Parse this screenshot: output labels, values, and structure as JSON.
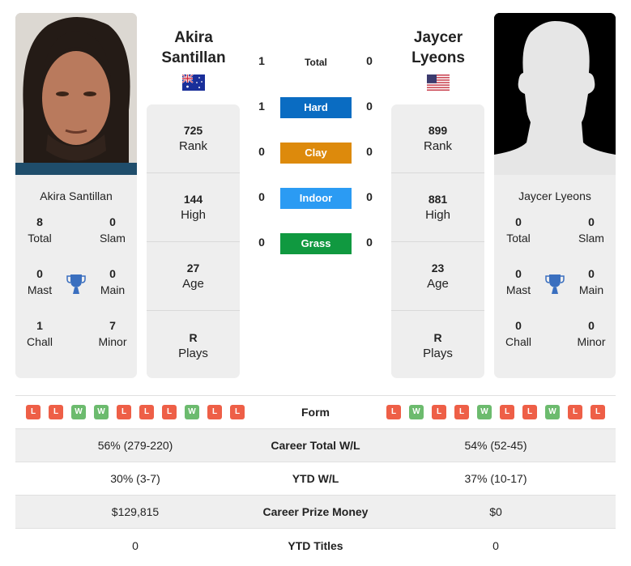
{
  "player1": {
    "name_line1": "Akira",
    "name_line2": "Santillan",
    "card_name": "Akira Santillan",
    "flag": "australia-flag",
    "photo": "player-photo",
    "stats": [
      {
        "value": "725",
        "label": "Rank"
      },
      {
        "value": "144",
        "label": "High"
      },
      {
        "value": "27",
        "label": "Age"
      },
      {
        "value": "R",
        "label": "Plays"
      }
    ],
    "titles": {
      "total": {
        "value": "8",
        "label": "Total"
      },
      "slam": {
        "value": "0",
        "label": "Slam"
      },
      "mast": {
        "value": "0",
        "label": "Mast"
      },
      "main": {
        "value": "0",
        "label": "Main"
      },
      "chall": {
        "value": "1",
        "label": "Chall"
      },
      "minor": {
        "value": "7",
        "label": "Minor"
      }
    },
    "form": [
      "L",
      "L",
      "W",
      "W",
      "L",
      "L",
      "L",
      "W",
      "L",
      "L"
    ]
  },
  "player2": {
    "name_line1": "Jaycer",
    "name_line2": "Lyeons",
    "card_name": "Jaycer Lyeons",
    "flag": "usa-flag",
    "photo": "silhouette-placeholder",
    "stats": [
      {
        "value": "899",
        "label": "Rank"
      },
      {
        "value": "881",
        "label": "High"
      },
      {
        "value": "23",
        "label": "Age"
      },
      {
        "value": "R",
        "label": "Plays"
      }
    ],
    "titles": {
      "total": {
        "value": "0",
        "label": "Total"
      },
      "slam": {
        "value": "0",
        "label": "Slam"
      },
      "mast": {
        "value": "0",
        "label": "Mast"
      },
      "main": {
        "value": "0",
        "label": "Main"
      },
      "chall": {
        "value": "0",
        "label": "Chall"
      },
      "minor": {
        "value": "0",
        "label": "Minor"
      }
    },
    "form": [
      "L",
      "W",
      "L",
      "L",
      "W",
      "L",
      "L",
      "W",
      "L",
      "L"
    ]
  },
  "h2h": [
    {
      "label": "Total",
      "p1": "1",
      "p2": "0",
      "color": ""
    },
    {
      "label": "Hard",
      "p1": "1",
      "p2": "0",
      "color": "#0a6cc2"
    },
    {
      "label": "Clay",
      "p1": "0",
      "p2": "0",
      "color": "#dd8a0c"
    },
    {
      "label": "Indoor",
      "p1": "0",
      "p2": "0",
      "color": "#2b9bf3"
    },
    {
      "label": "Grass",
      "p1": "0",
      "p2": "0",
      "color": "#109940"
    }
  ],
  "comparison": {
    "form_label": "Form",
    "rows": [
      {
        "label": "Career Total W/L",
        "p1": "56% (279-220)",
        "p2": "54% (52-45)"
      },
      {
        "label": "YTD W/L",
        "p1": "30% (3-7)",
        "p2": "37% (10-17)"
      },
      {
        "label": "Career Prize Money",
        "p1": "$129,815",
        "p2": "$0"
      },
      {
        "label": "YTD Titles",
        "p1": "0",
        "p2": "0"
      }
    ]
  },
  "colors": {
    "win": "#6cbb6e",
    "loss": "#ee5f47",
    "trophy": "#3a6fbf",
    "card_bg": "#eeeeee"
  }
}
